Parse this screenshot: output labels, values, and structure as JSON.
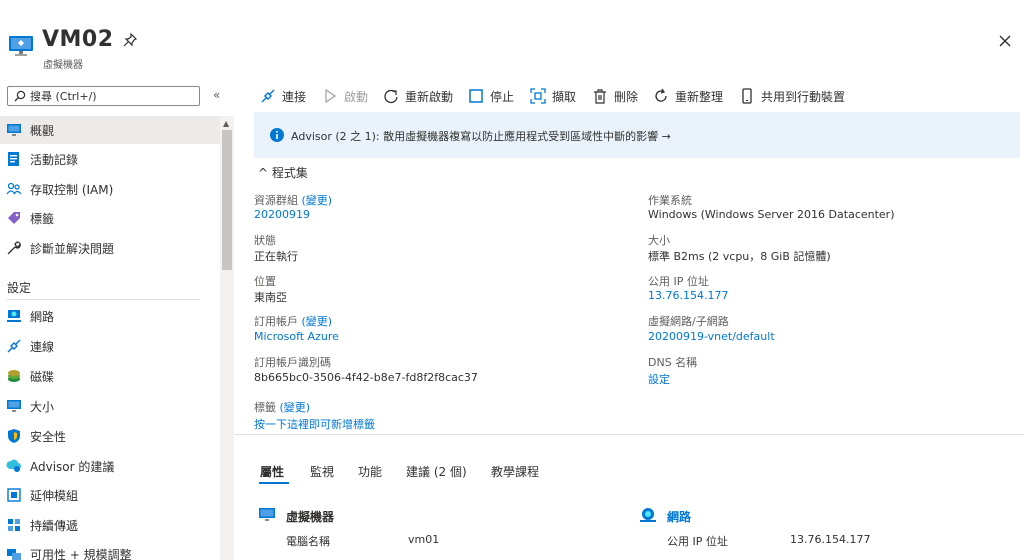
{
  "header": {
    "title": "VM02",
    "subtitle": "虛擬機器"
  },
  "sidebar": {
    "search_placeholder": "搜尋 (Ctrl+/)",
    "collapse": "«",
    "items": [
      {
        "label": "概觀",
        "icon": "monitor-icon"
      },
      {
        "label": "活動記錄",
        "icon": "activity-log-icon"
      },
      {
        "label": "存取控制 (IAM)",
        "icon": "people-icon"
      },
      {
        "label": "標籤",
        "icon": "tag-icon"
      },
      {
        "label": "診斷並解決問題",
        "icon": "wrench-icon"
      }
    ],
    "section_settings": "設定",
    "settings_items": [
      {
        "label": "網路",
        "icon": "network-icon"
      },
      {
        "label": "連線",
        "icon": "connect-icon"
      },
      {
        "label": "磁碟",
        "icon": "disk-icon"
      },
      {
        "label": "大小",
        "icon": "monitor-icon"
      },
      {
        "label": "安全性",
        "icon": "shield-icon"
      },
      {
        "label": "Advisor 的建議",
        "icon": "advisor-icon"
      },
      {
        "label": "延伸模組",
        "icon": "extension-icon"
      },
      {
        "label": "持續傳遞",
        "icon": "delivery-icon"
      },
      {
        "label": "可用性 + 規模調整",
        "icon": "availability-icon"
      }
    ]
  },
  "toolbar": {
    "connect": "連接",
    "start": "啟動",
    "restart": "重新啟動",
    "stop": "停止",
    "capture": "擷取",
    "delete": "刪除",
    "refresh": "重新整理",
    "mobile": "共用到行動裝置"
  },
  "advisor": {
    "text": "Advisor (2 之 1): 散用虛擬機器複寫以防止應用程式受到區域性中斷的影響 →"
  },
  "essentials": {
    "toggle": "程式集",
    "resource_group_label": "資源群組",
    "change": "(變更)",
    "resource_group": "20200919",
    "status_label": "狀態",
    "status": "正在執行",
    "location_label": "位置",
    "location": "東南亞",
    "subscription_label": "訂用帳戶",
    "subscription": "Microsoft Azure",
    "subscription_id_label": "訂用帳戶識別碼",
    "subscription_id": "8b665bc0-3506-4f42-b8e7-fd8f2f8cac37",
    "os_label": "作業系統",
    "os": "Windows (Windows Server 2016 Datacenter)",
    "size_label": "大小",
    "size": "標準 B2ms (2 vcpu，8 GiB 記憶體)",
    "public_ip_label": "公用 IP 位址",
    "public_ip": "13.76.154.177",
    "vnet_label": "虛擬網路/子網路",
    "vnet": "20200919-vnet/default",
    "dns_label": "DNS 名稱",
    "dns": "設定",
    "tags_label": "標籤",
    "tags_add": "按一下這裡即可新增標籤"
  },
  "tabs": [
    "屬性",
    "監視",
    "功能",
    "建議 (2 個)",
    "教學課程"
  ],
  "properties": {
    "vm_head": "虛擬機器",
    "computer_name_label": "電腦名稱",
    "computer_name": "vm01",
    "network_head": "網路",
    "public_ip_label": "公用 IP 位址",
    "public_ip": "13.76.154.177"
  },
  "colors": {
    "accent": "#0078d4",
    "banner": "#eaf3fc",
    "active_nav": "#edebe9"
  }
}
